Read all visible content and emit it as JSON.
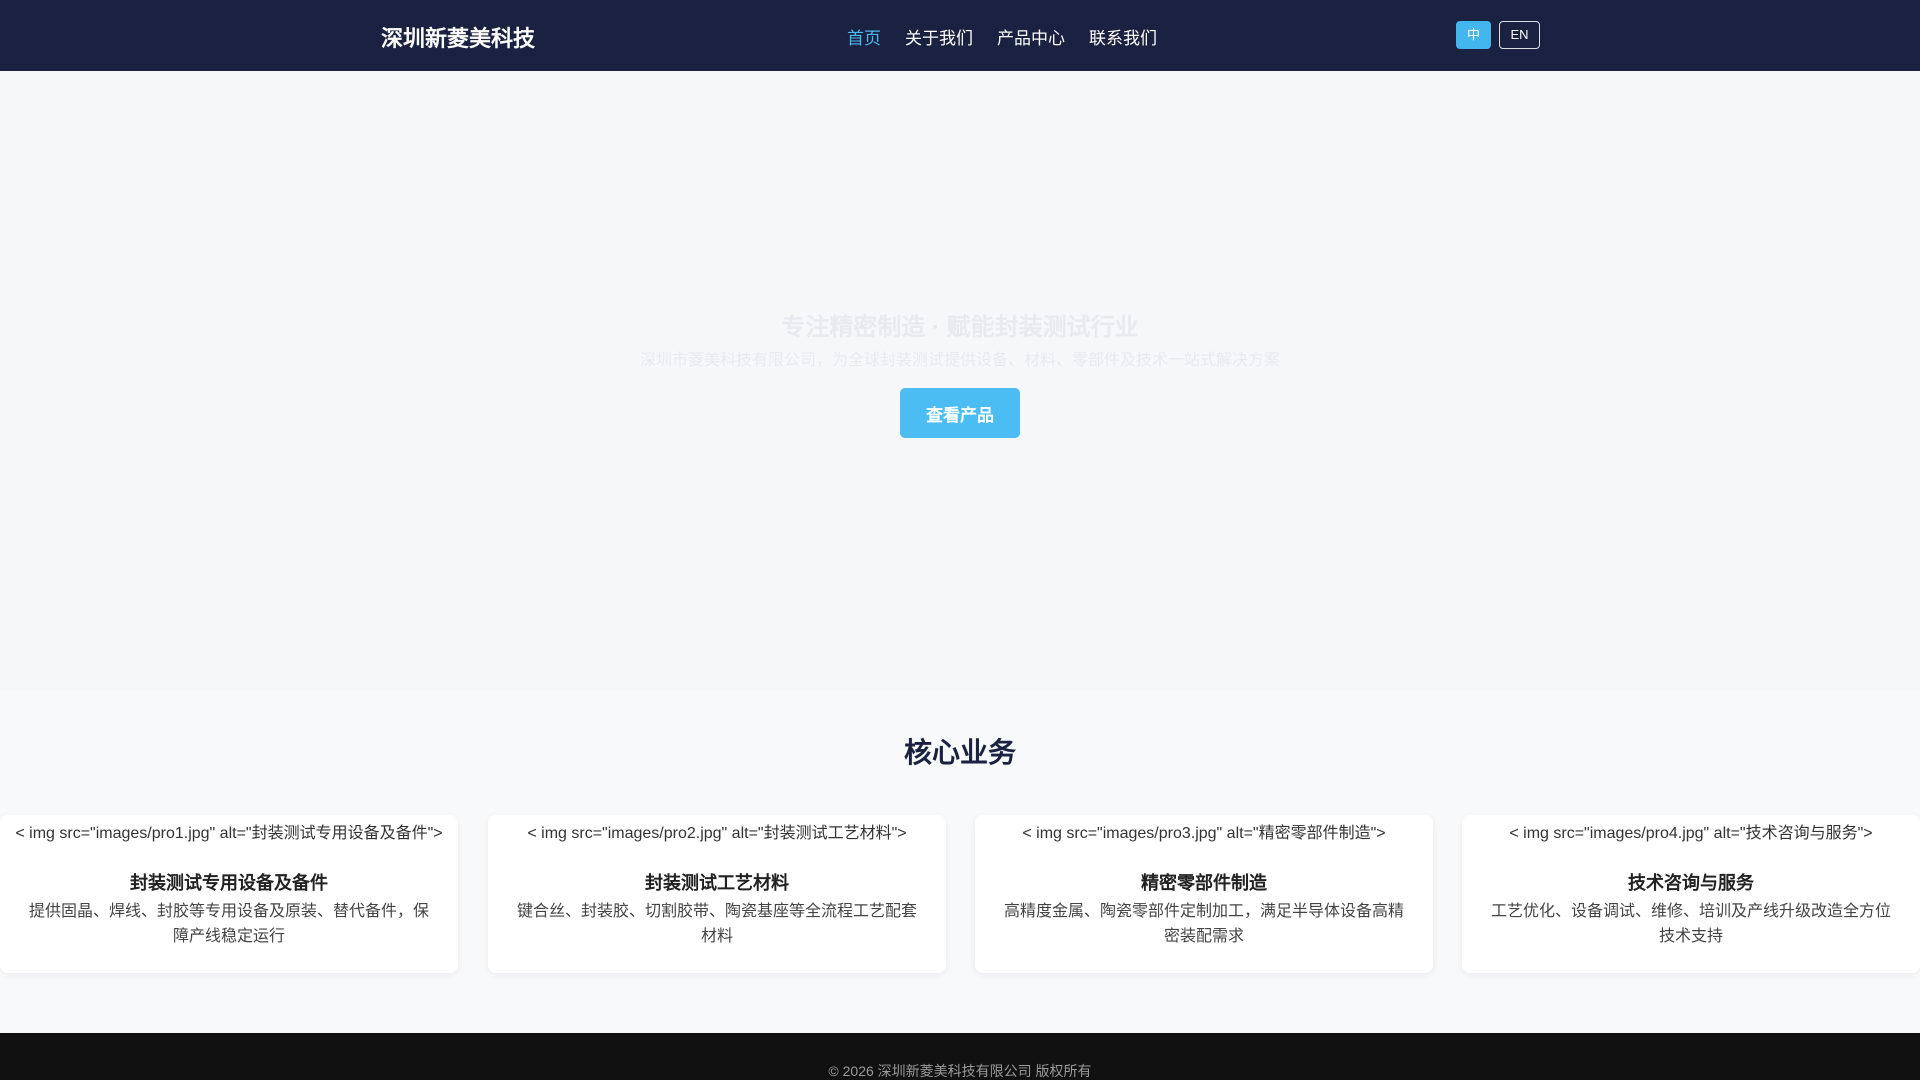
{
  "header": {
    "brand": "深圳新菱美科技",
    "nav": [
      {
        "label": "首页",
        "active": true
      },
      {
        "label": "关于我们",
        "active": false
      },
      {
        "label": "产品中心",
        "active": false
      },
      {
        "label": "联系我们",
        "active": false
      }
    ],
    "lang": {
      "zh": "中",
      "en": "EN"
    }
  },
  "hero": {
    "title": "专注精密制造 · 赋能封装测试行业",
    "subtitle": "深圳市菱美科技有限公司，为全球封装测试提供设备、材料、零部件及技术一站式解决方案",
    "button": "查看产品"
  },
  "core": {
    "title": "核心业务",
    "cards": [
      {
        "img_text": "< img src=\"images/pro1.jpg\" alt=\"封装测试专用设备及备件\">",
        "title": "封装测试专用设备及备件",
        "desc": "提供固晶、焊线、封胶等专用设备及原装、替代备件，保障产线稳定运行"
      },
      {
        "img_text": "< img src=\"images/pro2.jpg\" alt=\"封装测试工艺材料\">",
        "title": "封装测试工艺材料",
        "desc": "键合丝、封装胶、切割胶带、陶瓷基座等全流程工艺配套材料"
      },
      {
        "img_text": "< img src=\"images/pro3.jpg\" alt=\"精密零部件制造\">",
        "title": "精密零部件制造",
        "desc": "高精度金属、陶瓷零部件定制加工，满足半导体设备高精密装配需求"
      },
      {
        "img_text": "< img src=\"images/pro4.jpg\" alt=\"技术咨询与服务\">",
        "title": "技术咨询与服务",
        "desc": "工艺优化、设备调试、维修、培训及产线升级改造全方位技术支持"
      }
    ]
  },
  "footer": {
    "text": "© 2026 深圳新菱美科技有限公司 版权所有"
  },
  "colors": {
    "header_bg": "#1b2140",
    "accent": "#4bbdf3",
    "footer_bg": "#111111"
  }
}
